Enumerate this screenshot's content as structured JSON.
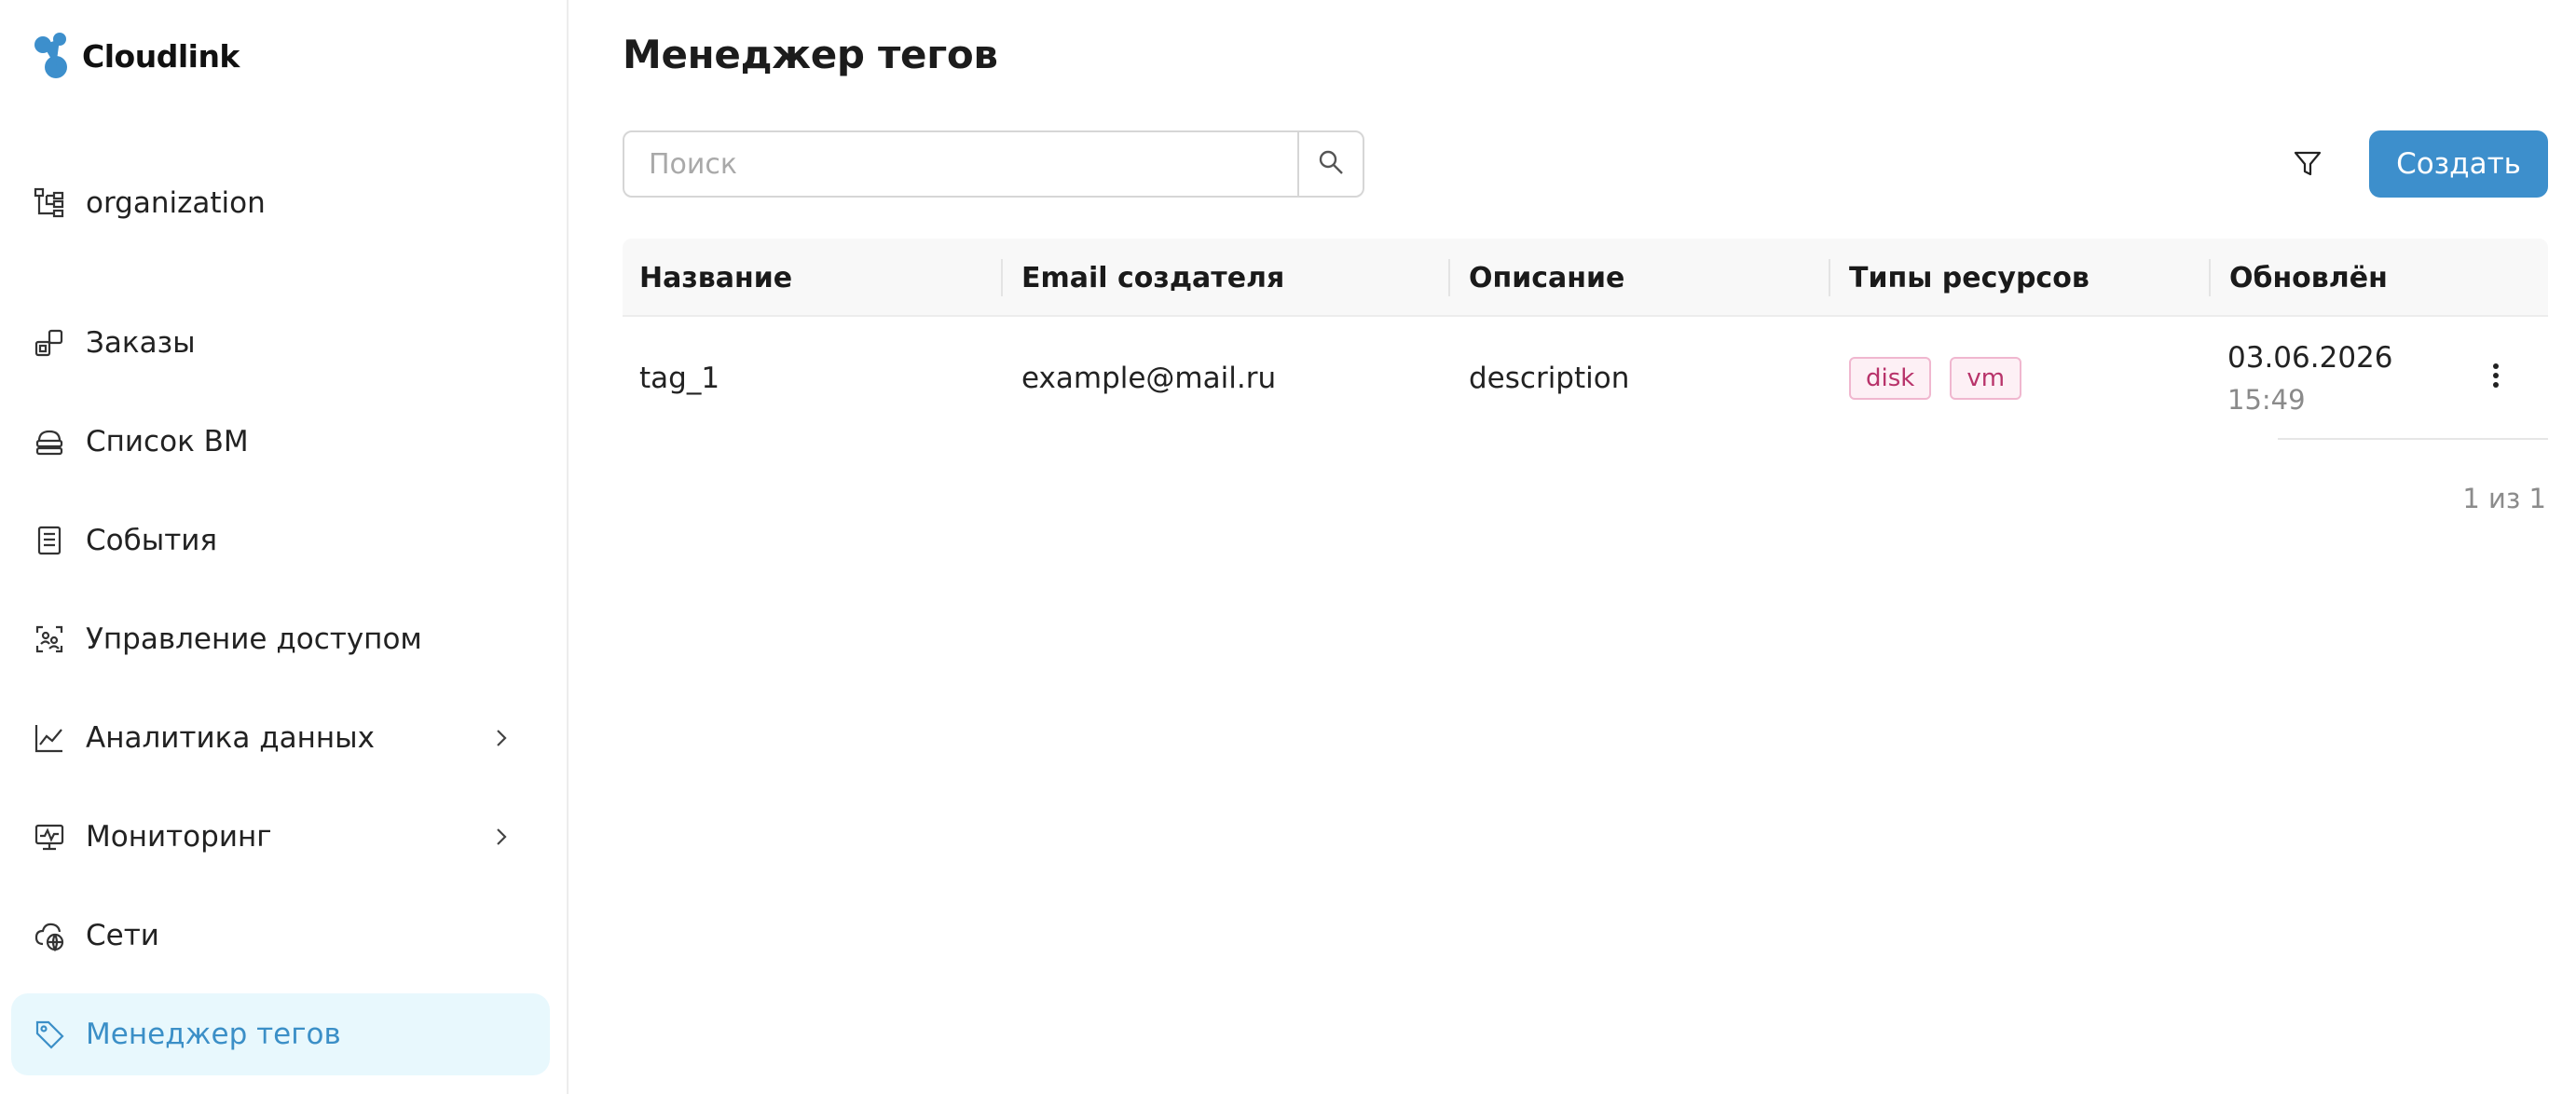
{
  "brand": {
    "name": "Cloudlink",
    "color": "#3d8fcc"
  },
  "sidebar": {
    "items": [
      {
        "label": "organization",
        "icon": "org-tree-icon",
        "active": false
      },
      {
        "label": "Заказы",
        "icon": "orders-icon",
        "active": false
      },
      {
        "label": "Список ВМ",
        "icon": "vm-list-icon",
        "active": false
      },
      {
        "label": "События",
        "icon": "events-icon",
        "active": false
      },
      {
        "label": "Управление доступом",
        "icon": "access-icon",
        "active": false
      },
      {
        "label": "Аналитика данных",
        "icon": "analytics-icon",
        "active": false,
        "expandable": true
      },
      {
        "label": "Мониторинг",
        "icon": "monitoring-icon",
        "active": false,
        "expandable": true
      },
      {
        "label": "Сети",
        "icon": "networks-icon",
        "active": false
      },
      {
        "label": "Менеджер тегов",
        "icon": "tag-icon",
        "active": true
      }
    ]
  },
  "page": {
    "title": "Менеджер тегов"
  },
  "toolbar": {
    "search_placeholder": "Поиск",
    "search_value": "",
    "create_label": "Создать"
  },
  "table": {
    "columns": [
      "Название",
      "Email создателя",
      "Описание",
      "Типы ресурсов",
      "Обновлён"
    ],
    "rows": [
      {
        "name": "tag_1",
        "email": "example@mail.ru",
        "description": "description",
        "resource_types": [
          "disk",
          "vm"
        ],
        "updated_date": "03.06.2026",
        "updated_time": "15:49"
      }
    ]
  },
  "pagination": {
    "label": "1 из 1"
  },
  "colors": {
    "accent": "#3d8fcc",
    "active_bg": "#e8f8fd",
    "tag_text": "#b8336a",
    "tag_border": "#f0b7cf",
    "tag_bg": "#fdf0f5"
  }
}
